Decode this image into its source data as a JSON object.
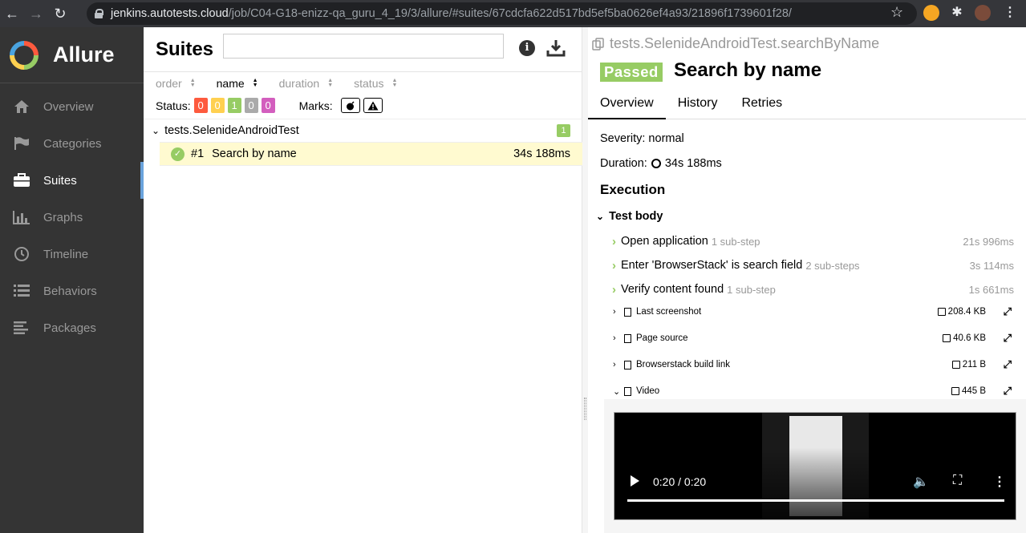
{
  "browser": {
    "url_host": "jenkins.autotests.cloud",
    "url_path": "/job/C04-G18-enizz-qa_guru_4_19/3/allure/#suites/67cdcfa622d517bd5ef5ba0626ef4a93/21896f1739601f28/"
  },
  "sidebar": {
    "brand": "Allure",
    "items": [
      {
        "label": "Overview",
        "icon": "home-icon"
      },
      {
        "label": "Categories",
        "icon": "flag-icon"
      },
      {
        "label": "Suites",
        "icon": "briefcase-icon"
      },
      {
        "label": "Graphs",
        "icon": "bar-chart-icon"
      },
      {
        "label": "Timeline",
        "icon": "clock-icon"
      },
      {
        "label": "Behaviors",
        "icon": "list-icon"
      },
      {
        "label": "Packages",
        "icon": "align-left-icon"
      }
    ],
    "active": "Suites"
  },
  "suites": {
    "title": "Suites",
    "search_placeholder": "",
    "sort": [
      "order",
      "name",
      "duration",
      "status"
    ],
    "status_label": "Status:",
    "status_counts": [
      {
        "value": "0",
        "color": "#fd5a3e"
      },
      {
        "value": "0",
        "color": "#ffd050"
      },
      {
        "value": "1",
        "color": "#97cc64"
      },
      {
        "value": "0",
        "color": "#aaaaaa"
      },
      {
        "value": "0",
        "color": "#d35ebe"
      }
    ],
    "marks_label": "Marks:",
    "group": {
      "name": "tests.SelenideAndroidTest",
      "count": "1"
    },
    "test": {
      "num": "#1",
      "name": "Search by name",
      "duration": "34s 188ms"
    }
  },
  "detail": {
    "path": "tests.SelenideAndroidTest.searchByName",
    "status": "Passed",
    "title": "Search by name",
    "tabs": [
      "Overview",
      "History",
      "Retries"
    ],
    "severity": "Severity: normal",
    "duration_label": "Duration:",
    "duration_value": "34s 188ms",
    "execution": "Execution",
    "test_body": "Test body",
    "steps": [
      {
        "name": "Open application",
        "sub": "1 sub-step",
        "dur": "21s 996ms"
      },
      {
        "name": "Enter 'BrowserStack' is search field",
        "sub": "2 sub-steps",
        "dur": "3s 114ms"
      },
      {
        "name": "Verify content found",
        "sub": "1 sub-step",
        "dur": "1s 661ms"
      }
    ],
    "attachments": [
      {
        "name": "Last screenshot",
        "size": "208.4 KB",
        "chev": "›"
      },
      {
        "name": "Page source",
        "size": "40.6 KB",
        "chev": "›"
      },
      {
        "name": "Browserstack build link",
        "size": "211 B",
        "chev": "›"
      },
      {
        "name": "Video",
        "size": "445 B",
        "chev": "⌄"
      }
    ],
    "video_time": "0:20 / 0:20"
  }
}
